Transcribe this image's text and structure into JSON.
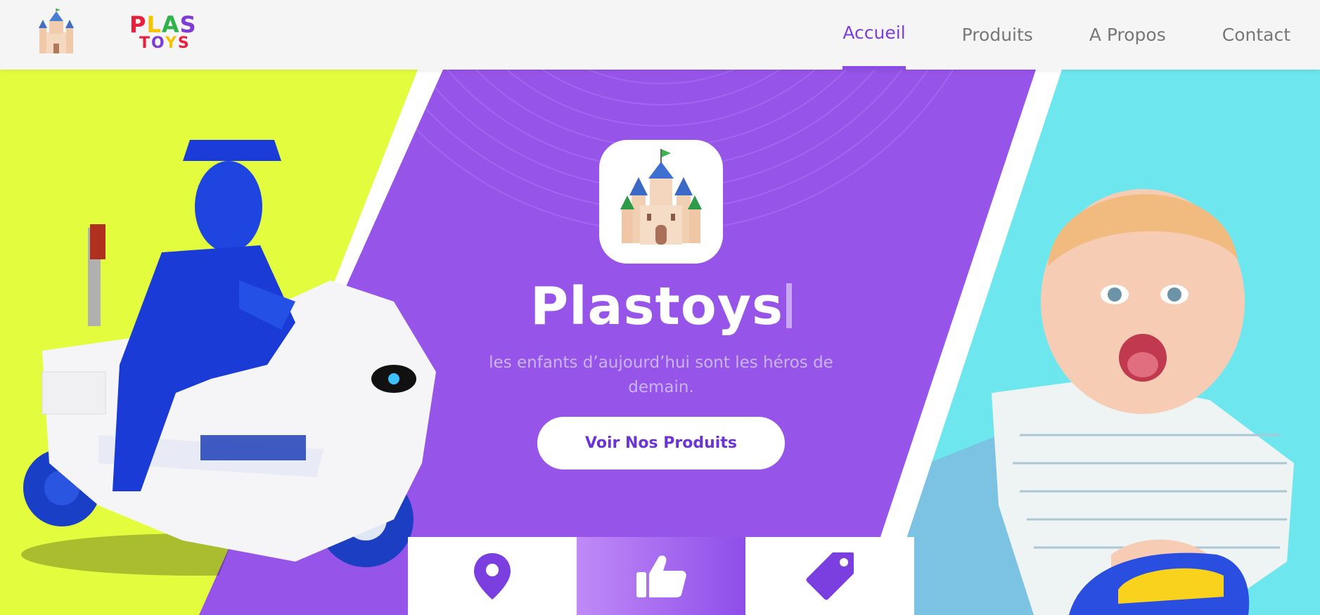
{
  "brand": {
    "logo_line1": "PLAS",
    "logo_line2": "TOYS",
    "logo_colors": [
      "#e8203c",
      "#f7c300",
      "#2db34a",
      "#7d3bd8"
    ]
  },
  "nav": {
    "items": [
      {
        "label": "Accueil",
        "active": true
      },
      {
        "label": "Produits",
        "active": false
      },
      {
        "label": "A Propos",
        "active": false
      },
      {
        "label": "Contact",
        "active": false
      }
    ]
  },
  "hero": {
    "title": "Plastoys",
    "subtitle": "les enfants d’aujourd’hui sont les héros de demain.",
    "cta_label": "Voir Nos Produits",
    "left_panel_color": "#e3fd3e",
    "center_panel_color": "#9754e8",
    "right_panel_color": "#6ee6ee"
  },
  "features": [
    {
      "icon": "location-pin-icon"
    },
    {
      "icon": "thumbs-up-icon"
    },
    {
      "icon": "price-tag-icon"
    }
  ],
  "colors": {
    "accent": "#7b3fe0",
    "nav_text": "#777777"
  }
}
